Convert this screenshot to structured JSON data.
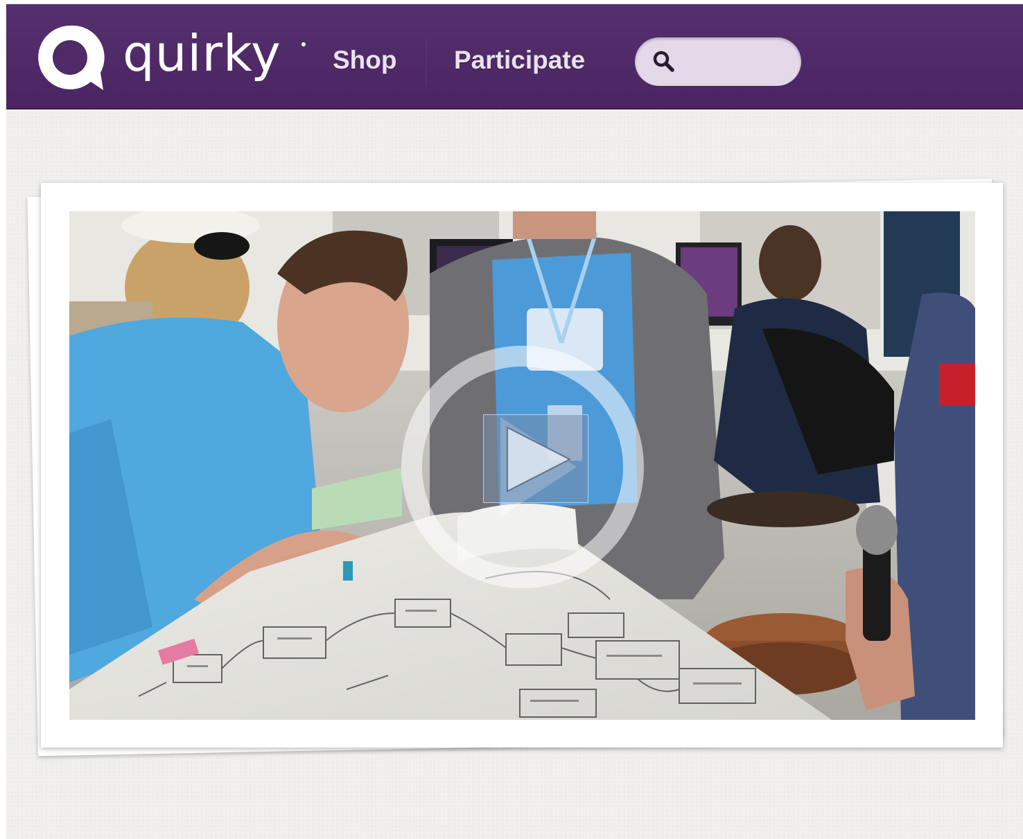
{
  "header": {
    "logo_text": "quirky",
    "logo_icon": "quirky-q-logo-icon",
    "brand_color": "#4f2a67",
    "nav": [
      {
        "label": "Shop"
      },
      {
        "label": "Participate"
      }
    ],
    "search": {
      "icon": "search-icon",
      "value": "",
      "placeholder": ""
    }
  },
  "main": {
    "video": {
      "icon": "play-icon"
    }
  }
}
